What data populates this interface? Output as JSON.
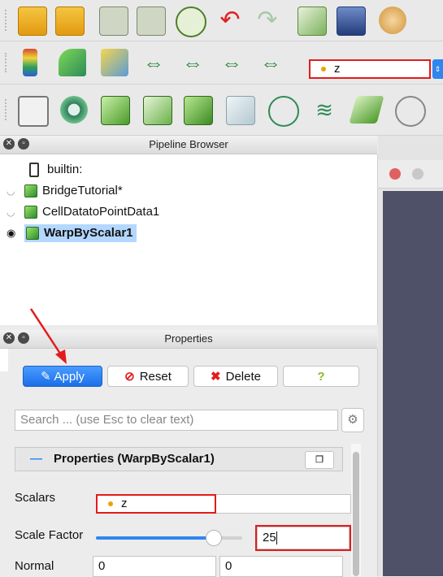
{
  "toolbar2": {
    "array_selector_value": "z"
  },
  "pipeline": {
    "title": "Pipeline Browser",
    "items": [
      {
        "label": "builtin:"
      },
      {
        "label": "BridgeTutorial*"
      },
      {
        "label": "CellDatatoPointData1"
      },
      {
        "label": "WarpByScalar1"
      }
    ]
  },
  "properties": {
    "title": "Properties",
    "apply_label": "Apply",
    "reset_label": "Reset",
    "delete_label": "Delete",
    "help_label": "?",
    "search_placeholder": "Search ... (use Esc to clear text)",
    "section_title": "Properties (WarpByScalar1)",
    "section_toggle": "—",
    "scalars_label": "Scalars",
    "scalars_value": "z",
    "scale_factor_label": "Scale Factor",
    "scale_factor_value": "25",
    "scale_factor_slider_fraction": 0.8,
    "normal_label": "Normal",
    "normal_x": "0",
    "normal_y": "0"
  },
  "colors": {
    "apply": "#2f86f0",
    "selection": "#b3d7ff",
    "annotation_red": "#e21c1c",
    "viewport": "#4f5168"
  }
}
